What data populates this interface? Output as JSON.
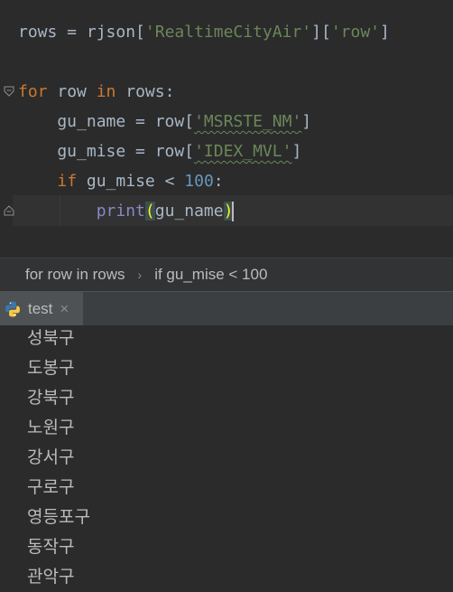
{
  "editor": {
    "lines": [
      {
        "parts": [
          [
            "rows = rjson[",
            ""
          ],
          [
            "'RealtimeCityAir'",
            "str"
          ],
          [
            "][",
            ""
          ],
          [
            "'row'",
            "str"
          ],
          [
            "]",
            ""
          ]
        ]
      },
      {
        "parts": []
      },
      {
        "parts": [
          [
            "for",
            "kw"
          ],
          [
            " row ",
            ""
          ],
          [
            "in",
            "kw"
          ],
          [
            " rows:",
            ""
          ]
        ]
      },
      {
        "parts": [
          [
            "    gu_name = row[",
            ""
          ],
          [
            "'MSRSTE_NM'",
            "str squiggle"
          ],
          [
            "]",
            ""
          ]
        ]
      },
      {
        "parts": [
          [
            "    gu_mise = row[",
            ""
          ],
          [
            "'IDEX_MVL'",
            "str squiggle"
          ],
          [
            "]",
            ""
          ]
        ]
      },
      {
        "parts": [
          [
            "    ",
            ""
          ],
          [
            "if",
            "kw"
          ],
          [
            " gu_mise < ",
            ""
          ],
          [
            "100",
            "num"
          ],
          [
            ":",
            ""
          ]
        ]
      },
      {
        "parts": [
          [
            "        ",
            ""
          ],
          [
            "print",
            "builtin"
          ],
          [
            "(",
            "brace-hl"
          ],
          [
            "gu_name",
            ""
          ],
          [
            ")",
            "brace-hl"
          ]
        ]
      }
    ]
  },
  "breadcrumb": {
    "item1": "for row in rows",
    "separator": "›",
    "item2": "if gu_mise < 100"
  },
  "run_panel": {
    "tab_label": "test",
    "close_glyph": "×",
    "output": [
      "성북구",
      "도봉구",
      "강북구",
      "노원구",
      "강서구",
      "구로구",
      "영등포구",
      "동작구",
      "관악구"
    ]
  },
  "colors": {
    "background": "#2b2b2b",
    "keyword": "#cc7832",
    "string": "#6a8759",
    "number": "#6897bb",
    "builtin": "#8888c6"
  },
  "icons": {
    "fold": "fold-icon",
    "python": "python-icon",
    "close": "close-icon"
  }
}
